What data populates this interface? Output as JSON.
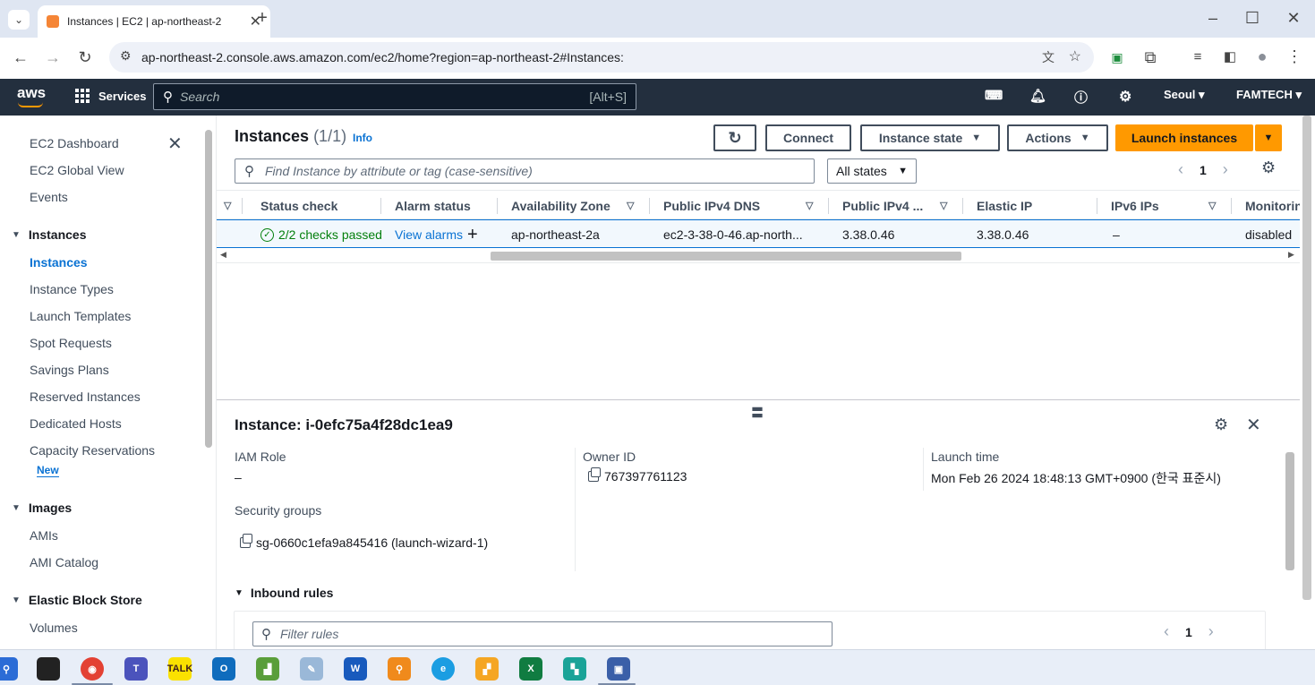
{
  "browser": {
    "tab_title": "Instances | EC2 | ap-northeast-2",
    "url": "ap-northeast-2.console.aws.amazon.com/ec2/home?region=ap-northeast-2#Instances:"
  },
  "aws": {
    "logo": "aws",
    "services_label": "Services",
    "search_placeholder": "Search",
    "search_shortcut": "[Alt+S]",
    "region": "Seoul",
    "account": "FAMTECH"
  },
  "sidebar": {
    "top_items": [
      "EC2 Dashboard",
      "EC2 Global View",
      "Events"
    ],
    "sections": [
      {
        "label": "Instances",
        "items": [
          "Instances",
          "Instance Types",
          "Launch Templates",
          "Spot Requests",
          "Savings Plans",
          "Reserved Instances",
          "Dedicated Hosts",
          "Capacity Reservations"
        ]
      },
      {
        "label": "Images",
        "items": [
          "AMIs",
          "AMI Catalog"
        ]
      },
      {
        "label": "Elastic Block Store",
        "items": [
          "Volumes"
        ]
      }
    ],
    "new_badge": "New",
    "active_item": "Instances"
  },
  "header": {
    "title": "Instances",
    "count": "(1/1)",
    "info": "Info",
    "connect": "Connect",
    "instance_state": "Instance state",
    "actions": "Actions",
    "launch": "Launch instances"
  },
  "filter": {
    "placeholder": "Find Instance by attribute or tag (case-sensitive)",
    "states": "All states",
    "page": "1"
  },
  "table": {
    "columns": [
      "Status check",
      "Alarm status",
      "Availability Zone",
      "Public IPv4 DNS",
      "Public IPv4 ...",
      "Elastic IP",
      "IPv6 IPs",
      "Monitoring"
    ],
    "rows": [
      {
        "status_check": "2/2 checks passed",
        "alarm": "View alarms",
        "az": "ap-northeast-2a",
        "dns": "ec2-3-38-0-46.ap-north...",
        "ipv4": "3.38.0.46",
        "elastic_ip": "3.38.0.46",
        "ipv6": "–",
        "monitoring": "disabled",
        "selected": true
      }
    ]
  },
  "details": {
    "title": "Instance: i-0efc75a4f28dc1ea9",
    "iam_role_label": "IAM Role",
    "iam_role_value": "–",
    "owner_label": "Owner ID",
    "owner_value": "767397761123",
    "launch_label": "Launch time",
    "launch_value": "Mon Feb 26 2024 18:48:13 GMT+0900 (한국 표준시)",
    "sg_label": "Security groups",
    "sg_value": "sg-0660c1efa9a845416 (launch-wizard-1)",
    "inbound_label": "Inbound rules",
    "rules_placeholder": "Filter rules",
    "rules_page": "1"
  },
  "colors": {
    "aws_nav": "#232f3e",
    "accent": "#ff9900",
    "link": "#0972d3",
    "success": "#037f0c"
  }
}
